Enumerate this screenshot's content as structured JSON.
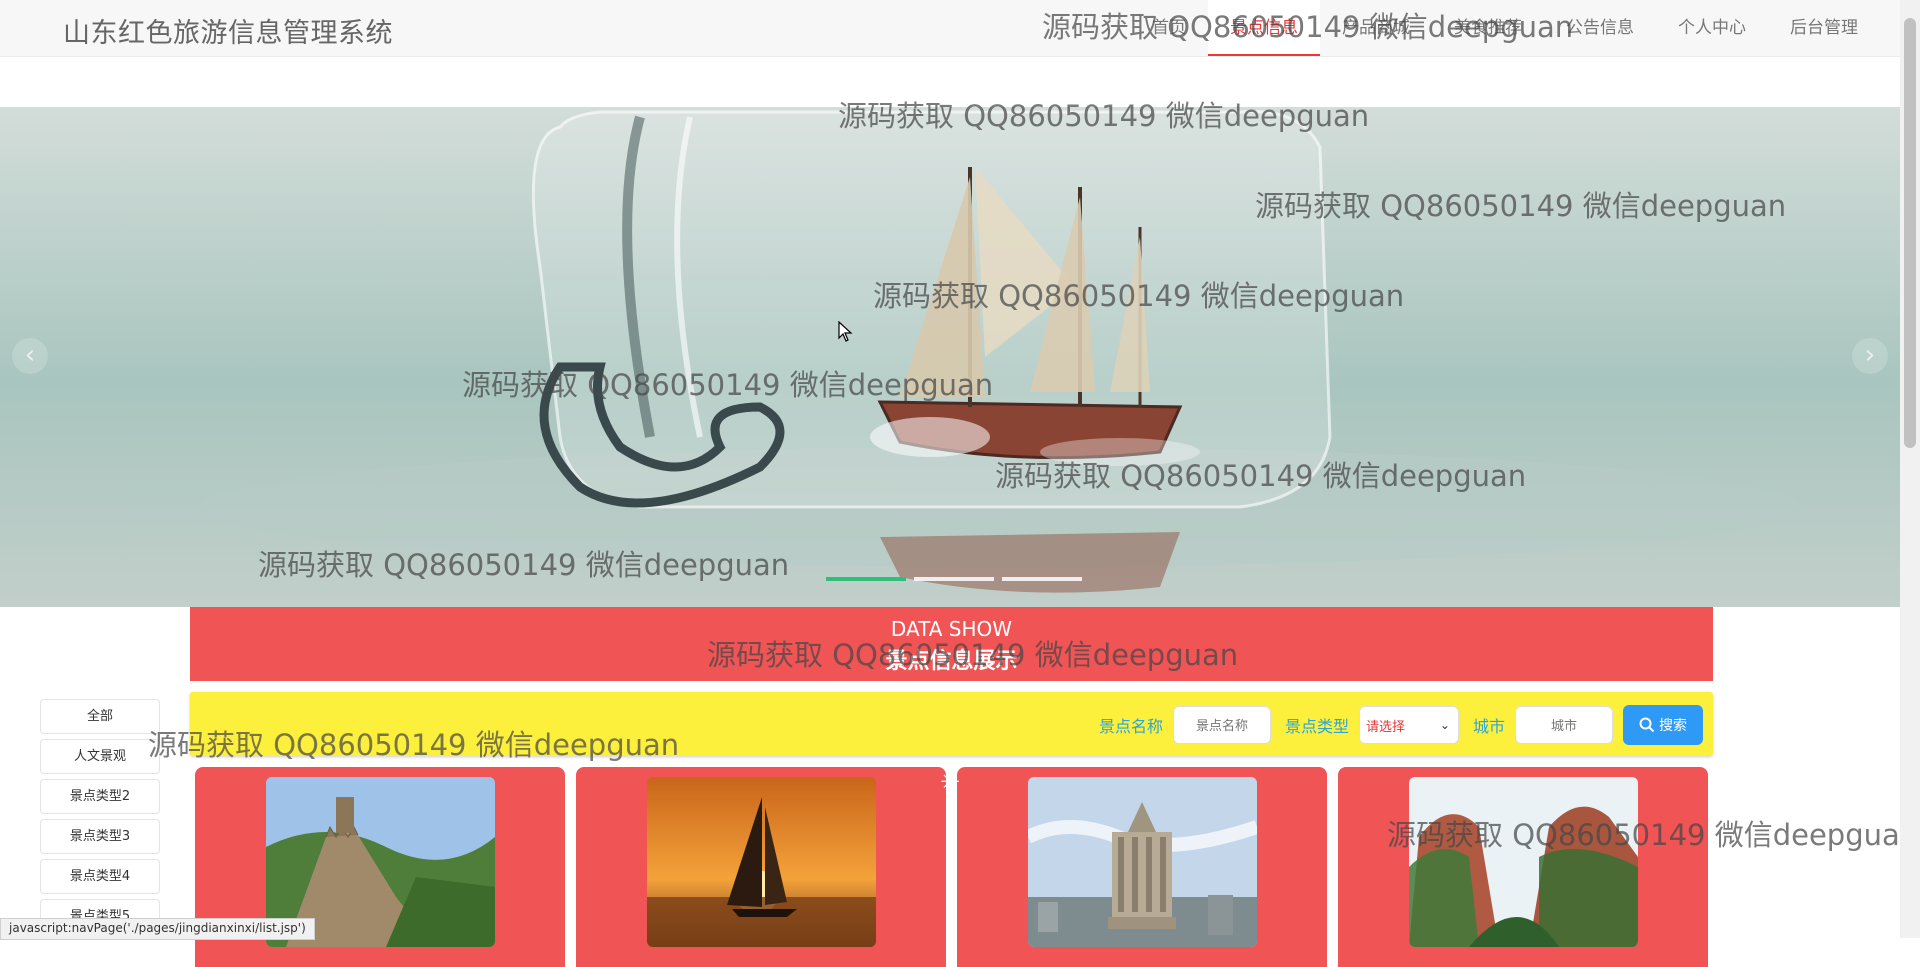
{
  "site": {
    "title": "山东红色旅游信息管理系统"
  },
  "nav": {
    "items": [
      {
        "label": "首页"
      },
      {
        "label": "景点信息"
      },
      {
        "label": "产品商城"
      },
      {
        "label": "美食推荐"
      },
      {
        "label": "公告信息"
      },
      {
        "label": "个人中心"
      },
      {
        "label": "后台管理"
      }
    ]
  },
  "carousel": {
    "prev": "‹",
    "next": "›"
  },
  "section": {
    "en": "DATA SHOW",
    "cn": "景点信息展示"
  },
  "sidebar": {
    "items": [
      {
        "label": "全部"
      },
      {
        "label": "人文景观"
      },
      {
        "label": "景点类型2"
      },
      {
        "label": "景点类型3"
      },
      {
        "label": "景点类型4"
      },
      {
        "label": "景点类型5"
      }
    ]
  },
  "search": {
    "name_label": "景点名称",
    "name_placeholder": "景点名称",
    "type_label": "景点类型",
    "type_selected": "请选择",
    "city_label": "城市",
    "city_placeholder": "城市",
    "button": "搜索"
  },
  "watermark": "源码获取 QQ86050149 微信deepguan",
  "status_bar": "javascript:navPage('./pages/jingdianxinxi/list.jsp')",
  "colors": {
    "accent_red": "#f05454",
    "search_bg": "#fdf03c",
    "label_blue": "#2aa6d8",
    "button_blue": "#2e9af5",
    "dot_active": "#2fbe7b"
  }
}
